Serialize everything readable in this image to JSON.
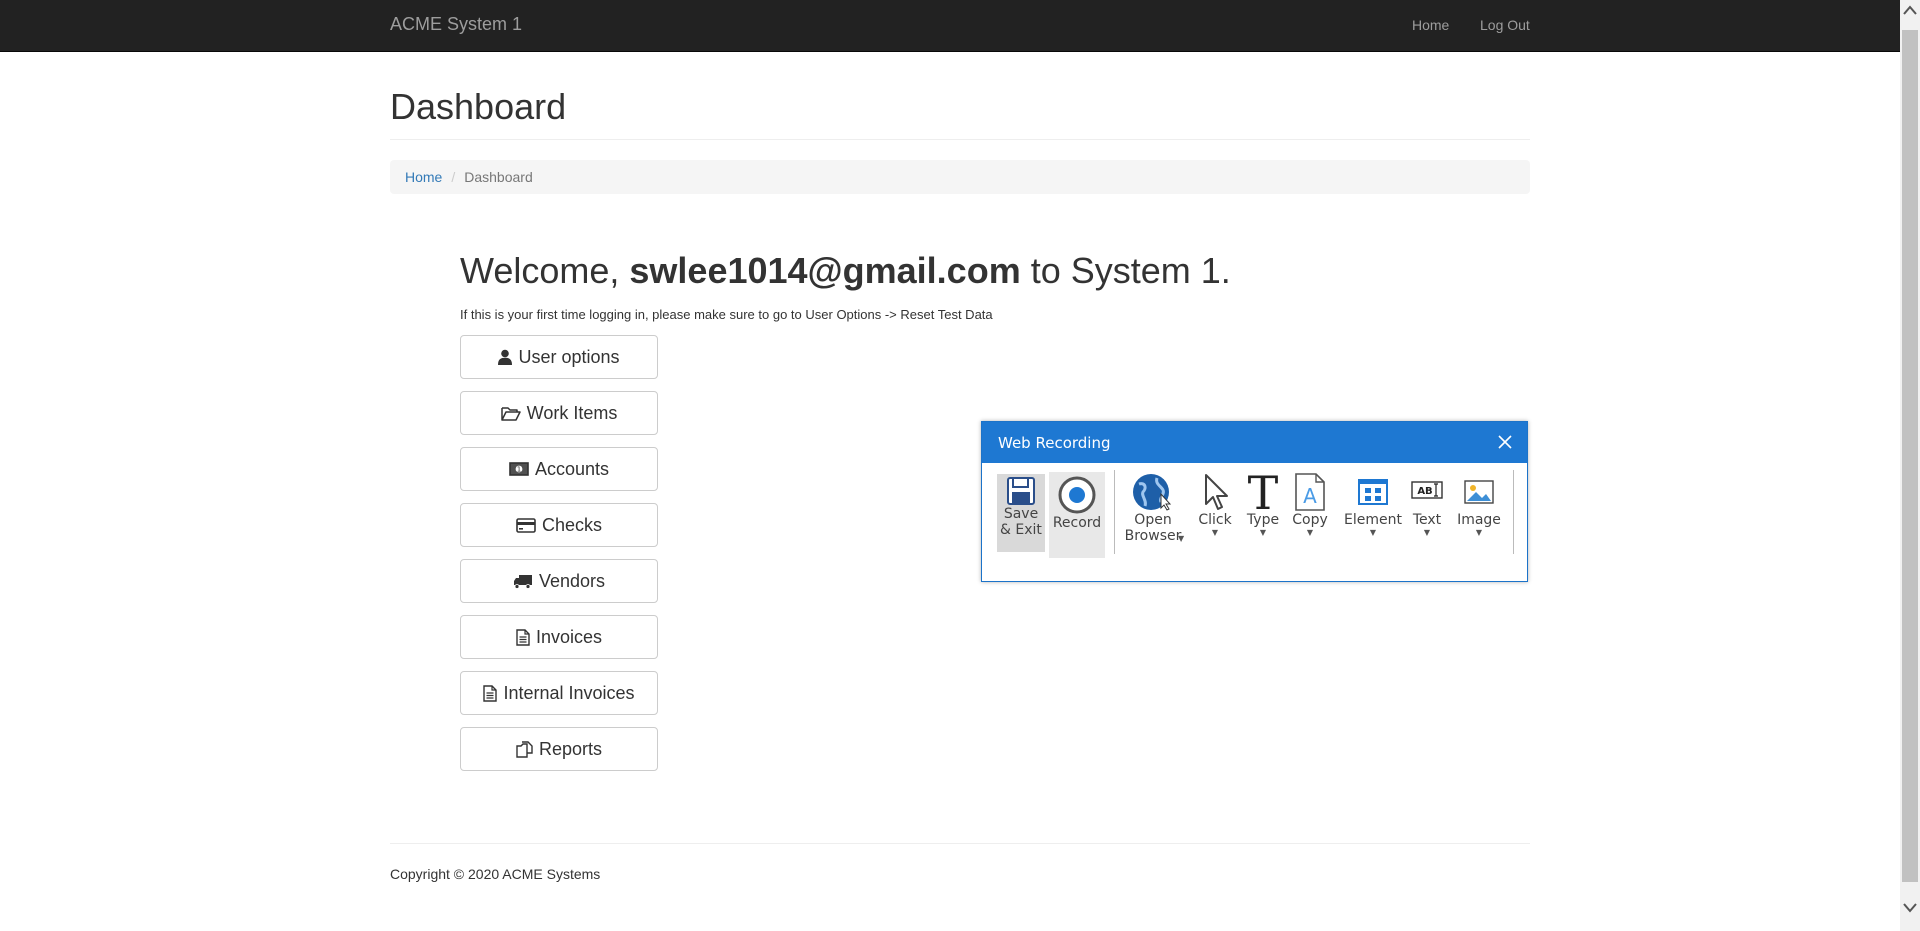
{
  "navbar": {
    "brand": "ACME System 1",
    "links": [
      {
        "label": "Home"
      },
      {
        "label": "Log Out"
      }
    ]
  },
  "page": {
    "title": "Dashboard",
    "breadcrumb": {
      "home": "Home",
      "separator": "/",
      "current": "Dashboard"
    }
  },
  "welcome": {
    "prefix": "Welcome, ",
    "user": "swlee1014@gmail.com",
    "suffix": " to System 1."
  },
  "notice": "If this is your first time logging in, please make sure to go to User Options -> Reset Test Data",
  "menu": [
    {
      "label": "User options",
      "icon": "user-icon"
    },
    {
      "label": "Work Items",
      "icon": "folder-open-icon"
    },
    {
      "label": "Accounts",
      "icon": "money-icon"
    },
    {
      "label": "Checks",
      "icon": "credit-card-icon"
    },
    {
      "label": "Vendors",
      "icon": "truck-icon"
    },
    {
      "label": "Invoices",
      "icon": "file-text-icon"
    },
    {
      "label": "Internal Invoices",
      "icon": "file-text-icon"
    },
    {
      "label": "Reports",
      "icon": "copy-icon"
    }
  ],
  "footer": "Copyright © 2020 ACME Systems",
  "recorder": {
    "title": "Web Recording",
    "save_label_1": "Save",
    "save_label_2": "& Exit",
    "record_label": "Record",
    "open_label_1": "Open",
    "open_label_2": "Browser",
    "click_label": "Click",
    "type_label": "Type",
    "copy_label": "Copy",
    "element_label": "Element",
    "text_label": "Text",
    "image_label": "Image",
    "accent": "#1e78d2"
  }
}
